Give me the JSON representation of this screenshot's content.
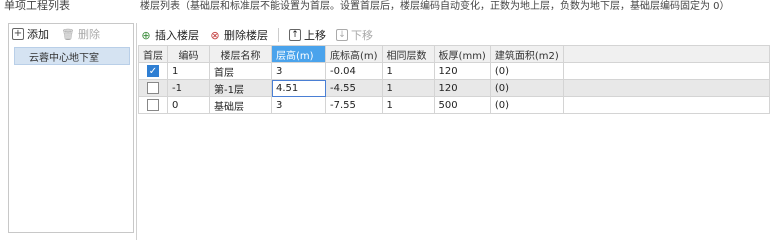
{
  "left": {
    "title": "单项工程列表",
    "add_label": "添加",
    "delete_label": "删除",
    "items": [
      {
        "label": "云蓉中心地下室"
      }
    ]
  },
  "right": {
    "title": "楼层列表（基础层和标准层不能设置为首层。设置首层后，楼层编码自动变化，正数为地上层，负数为地下层，基础层编码固定为 0）",
    "toolbar": {
      "insert_label": "插入楼层",
      "delete_label": "删除楼层",
      "up_label": "上移",
      "down_label": "下移"
    },
    "columns": [
      "首层",
      "编码",
      "楼层名称",
      "层高(m)",
      "底标高(m)",
      "相同层数",
      "板厚(mm)",
      "建筑面积(m2)"
    ],
    "rows": [
      {
        "first": true,
        "code": "1",
        "name": "首层",
        "height": "3",
        "bottom": "-0.04",
        "same": "1",
        "thick": "120",
        "area": "(0)"
      },
      {
        "first": false,
        "code": "-1",
        "name": "第-1层",
        "height": "4.51",
        "bottom": "-4.55",
        "same": "1",
        "thick": "120",
        "area": "(0)"
      },
      {
        "first": false,
        "code": "0",
        "name": "基础层",
        "height": "3",
        "bottom": "-7.55",
        "same": "1",
        "thick": "500",
        "area": "(0)"
      }
    ]
  }
}
